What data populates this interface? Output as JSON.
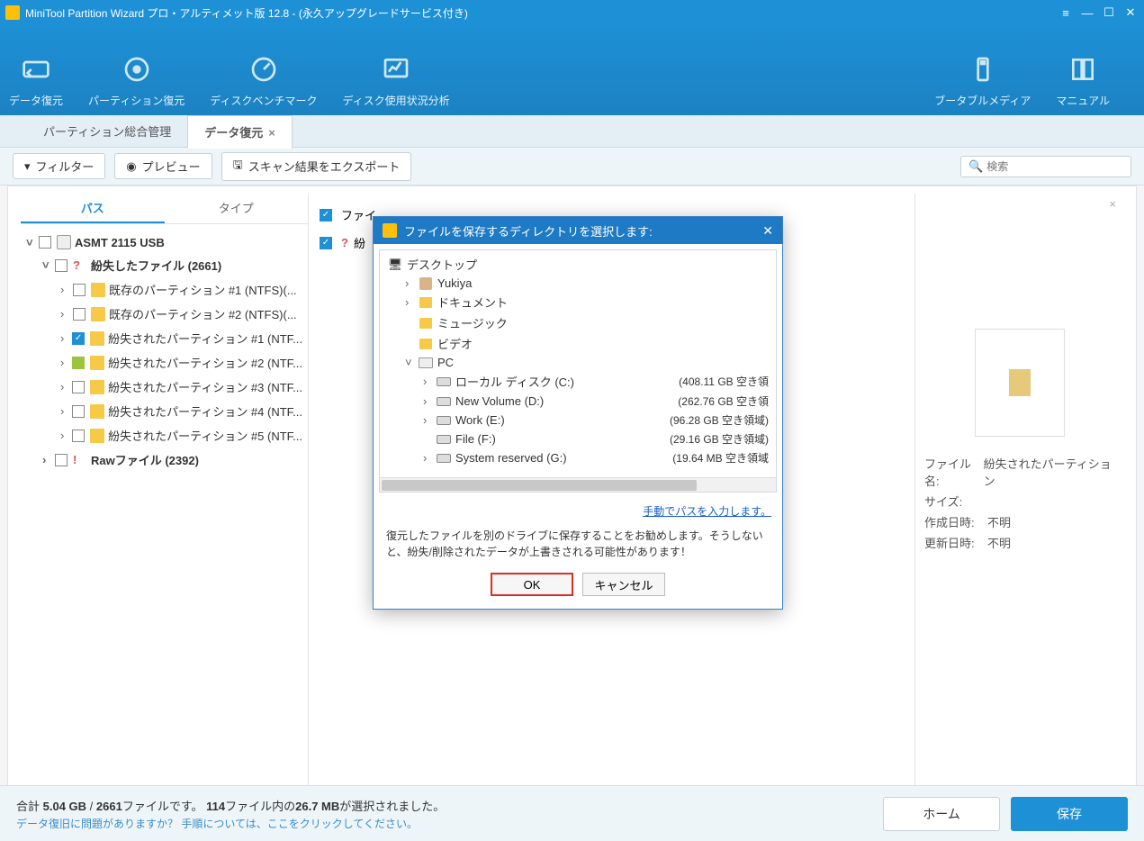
{
  "titlebar": {
    "title": "MiniTool Partition Wizard プロ・アルティメット版 12.8 - (永久アップグレードサービス付き)"
  },
  "ribbon": {
    "recover": "データ復元",
    "partition_recover": "パーティション復元",
    "benchmark": "ディスクベンチマーク",
    "usage": "ディスク使用状況分析",
    "bootable": "ブータブルメディア",
    "manual": "マニュアル"
  },
  "tabs": {
    "manage": "パーティション総合管理",
    "recover": "データ復元"
  },
  "actionbar": {
    "filter": "フィルター",
    "preview": "プレビュー",
    "export": "スキャン結果をエクスポート",
    "search_placeholder": "検索"
  },
  "lefttabs": {
    "path": "パス",
    "type": "タイプ"
  },
  "tree": {
    "root": "ASMT 2115 USB",
    "lost_files": "紛失したファイル (2661)",
    "items": [
      "既存のパーティション #1 (NTFS)(...",
      "既存のパーティション #2 (NTFS)(...",
      "紛失されたパーティション #1 (NTF...",
      "紛失されたパーティション #2 (NTF...",
      "紛失されたパーティション #3 (NTF...",
      "紛失されたパーティション #4 (NTF...",
      "紛失されたパーティション #5 (NTF..."
    ],
    "raw": "Rawファイル (2392)"
  },
  "filelist": {
    "col1": "ファイ",
    "col2": "紛"
  },
  "preview": {
    "filename_k": "ファイル名:",
    "filename_v": "紛失されたパーティション",
    "size_k": "サイズ:",
    "size_v": "",
    "created_k": "作成日時:",
    "created_v": "不明",
    "updated_k": "更新日時:",
    "updated_v": "不明"
  },
  "status": {
    "line1_a": "合計 ",
    "line1_b": "5.04 GB",
    "line1_c": " / ",
    "line1_d": "2661",
    "line1_e": "ファイルです。",
    "line1_f": "114",
    "line1_g": "ファイル内の",
    "line1_h": "26.7 MB",
    "line1_i": "が選択されました。",
    "line2": "データ復旧に問題がありますか？ 手順については、ここをクリックしてください。",
    "home": "ホーム",
    "save": "保存"
  },
  "dialog": {
    "title": "ファイルを保存するディレクトリを選択します:",
    "desktop": "デスクトップ",
    "yukiya": "Yukiya",
    "documents": "ドキュメント",
    "music": "ミュージック",
    "video": "ビデオ",
    "pc": "PC",
    "drives": [
      {
        "label": "ローカル ディスク (C:)",
        "free": "(408.11 GB 空き領"
      },
      {
        "label": "New Volume (D:)",
        "free": "(262.76 GB 空き領"
      },
      {
        "label": "Work (E:)",
        "free": "(96.28 GB 空き領域)"
      },
      {
        "label": "File (F:)",
        "free": "(29.16 GB 空き領域)"
      },
      {
        "label": "System reserved (G:)",
        "free": "(19.64 MB 空き領域"
      }
    ],
    "manual_link": "手動でパスを入力します。",
    "msg": "復元したファイルを別のドライブに保存することをお勧めします。そうしないと、紛失/削除されたデータが上書きされる可能性があります！",
    "ok": "OK",
    "cancel": "キャンセル"
  }
}
